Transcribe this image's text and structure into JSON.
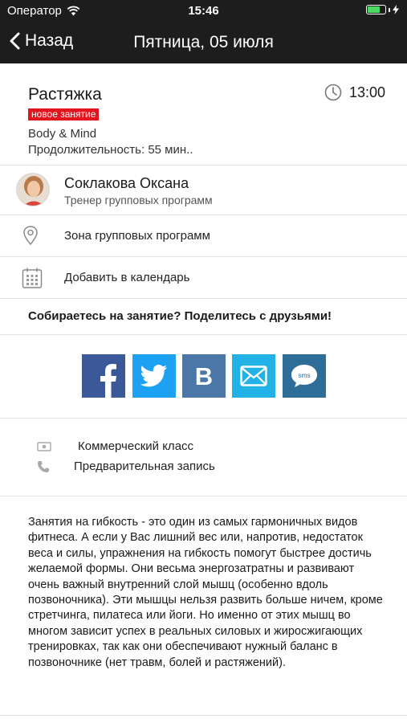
{
  "status_bar": {
    "carrier": "Оператор",
    "time": "15:46",
    "battery_level": 0.7
  },
  "nav": {
    "back_label": "Назад",
    "title": "Пятница, 05 июля"
  },
  "class": {
    "name": "Растяжка",
    "badge": "новое занятие",
    "category": "Body & Mind",
    "duration": "Продолжительность: 55 мин..",
    "time": "13:00"
  },
  "trainer": {
    "name": "Соклакова Оксана",
    "role": "Тренер групповых программ"
  },
  "location": {
    "label": "Зона групповых программ"
  },
  "calendar": {
    "label": "Добавить в календарь"
  },
  "share": {
    "title": "Собираетесь на занятие? Поделитесь с друзьями!",
    "buttons": [
      {
        "icon": "facebook-icon",
        "color": "#3b5998"
      },
      {
        "icon": "twitter-icon",
        "color": "#1da1f2"
      },
      {
        "icon": "vk-icon",
        "color": "#4a76a8"
      },
      {
        "icon": "mail-icon",
        "color": "#23b2e5"
      },
      {
        "icon": "sms-icon",
        "color": "#2e6d98"
      }
    ]
  },
  "info": {
    "commercial": "Коммерческий класс",
    "booking": "Предварительная запись"
  },
  "description": "Занятия на гибкость - это один из самых гармоничных видов фитнеса. А если у Вас лишний вес или, напротив, недостаток веса и силы, упражнения на гибкость помогут быстрее достичь желаемой формы. Они весьма энергозатратны и развивают очень важный внутренний слой мышц (особенно вдоль позвоночника). Эти мышцы нельзя развить больше ничем, кроме стретчинга, пилатеса или йоги. Но именно от этих мышц во многом зависит успех в реальных силовых и жиросжигающих тренировках, так как они обеспечивают нужный баланс в позвоночнике (нет травм, болей и растяжений).",
  "colors": {
    "topbar": "#1d1d1d",
    "badge": "#e3141e",
    "battery": "#4cd964"
  }
}
